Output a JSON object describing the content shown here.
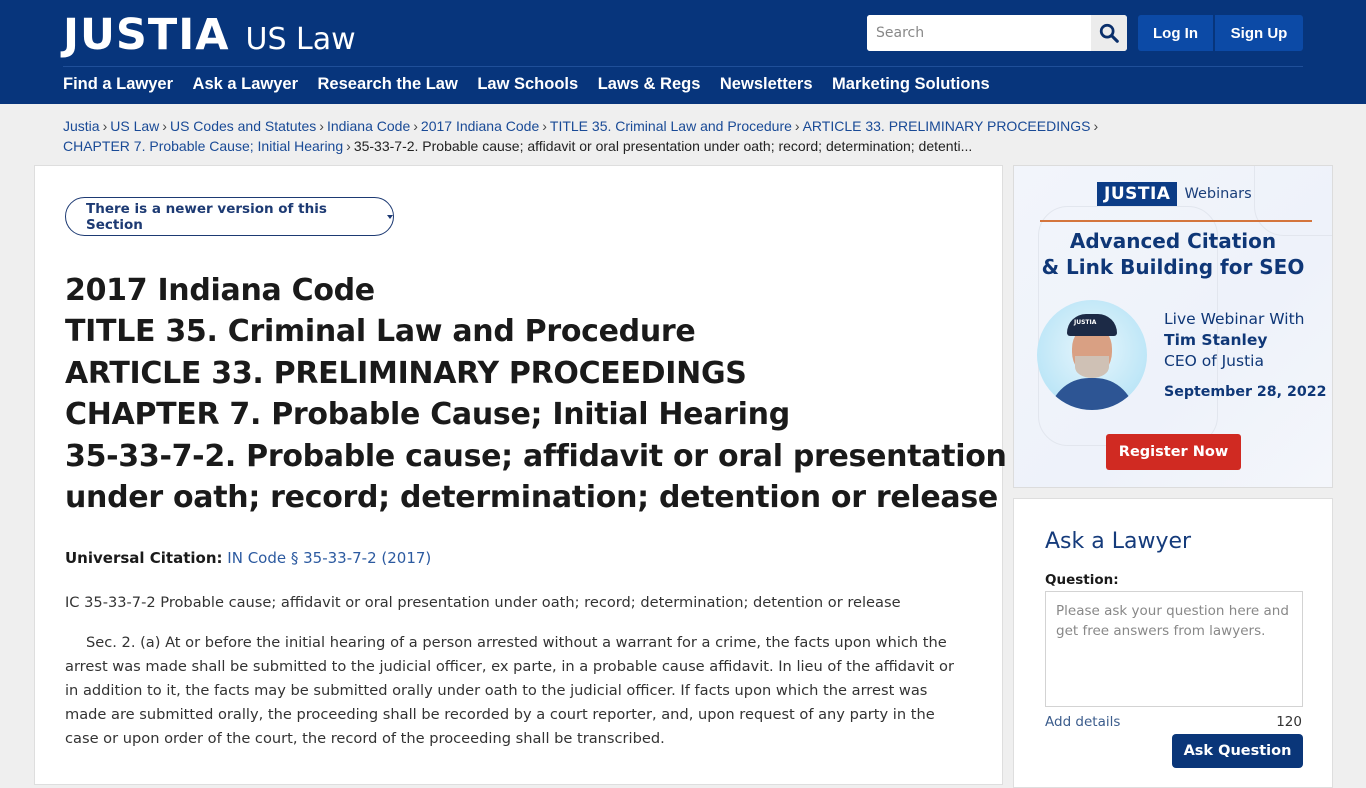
{
  "header": {
    "logo_main": "JUSTIA",
    "logo_sub": "US Law",
    "search_placeholder": "Search",
    "login_label": "Log In",
    "signup_label": "Sign Up",
    "nav": [
      {
        "label": "Find a Lawyer"
      },
      {
        "label": "Ask a Lawyer"
      },
      {
        "label": "Research the Law"
      },
      {
        "label": "Law Schools"
      },
      {
        "label": "Laws & Regs"
      },
      {
        "label": "Newsletters"
      },
      {
        "label": "Marketing Solutions"
      }
    ]
  },
  "breadcrumb": {
    "separator": "›",
    "links": [
      {
        "label": "Justia"
      },
      {
        "label": "US Law"
      },
      {
        "label": "US Codes and Statutes"
      },
      {
        "label": "Indiana Code"
      },
      {
        "label": "2017 Indiana Code"
      },
      {
        "label": "TITLE 35. Criminal Law and Procedure"
      },
      {
        "label": "ARTICLE 33. PRELIMINARY PROCEEDINGS"
      },
      {
        "label": "CHAPTER 7. Probable Cause; Initial Hearing"
      }
    ],
    "current": "35-33-7-2. Probable cause; affidavit or oral presentation under oath; record; determination; detenti..."
  },
  "main": {
    "version_button": "There is a newer version of this Section",
    "title_lines": [
      "2017 Indiana Code",
      "TITLE 35. Criminal Law and Procedure",
      "ARTICLE 33. PRELIMINARY PROCEEDINGS",
      "CHAPTER 7. Probable Cause; Initial Hearing",
      "35-33-7-2. Probable cause; affidavit or oral presentation",
      "under oath; record; determination; detention or release"
    ],
    "citation_label": "Universal Citation:",
    "citation_link": "IN Code § 35-33-7-2 (2017)",
    "lead": "IC 35-33-7-2 Probable cause; affidavit or oral presentation under oath; record; determination; detention or release",
    "body": "Sec. 2. (a) At or before the initial hearing of a person arrested without a warrant for a crime, the facts upon which the arrest was made shall be submitted to the judicial officer, ex parte, in a probable cause affidavit. In lieu of the affidavit or in addition to it, the facts may be submitted orally under oath to the judicial officer. If facts upon which the arrest was made are submitted orally, the proceeding shall be recorded by a court reporter, and, upon request of any party in the case or upon order of the court, the record of the proceeding shall be transcribed."
  },
  "ad": {
    "logo": "JUSTIA",
    "logo_sub": "Webinars",
    "title_line1": "Advanced Citation",
    "title_line2": "& Link Building for SEO",
    "avatar_cap_text": "JUSTIA",
    "line1": "Live Webinar With",
    "presenter": "Tim Stanley",
    "role": "CEO of Justia",
    "date": "September 28, 2022",
    "button": "Register Now",
    "accent_color": "#d4753d",
    "button_color": "#d02a22"
  },
  "ask_lawyer": {
    "title": "Ask a Lawyer",
    "question_label": "Question:",
    "placeholder": "Please ask your question here and get free answers from lawyers.",
    "add_details": "Add details",
    "char_count": "120",
    "button": "Ask Question"
  },
  "colors": {
    "brand_navy": "#07357c",
    "link_blue": "#194a96",
    "button_blue": "#0c4aa6"
  }
}
